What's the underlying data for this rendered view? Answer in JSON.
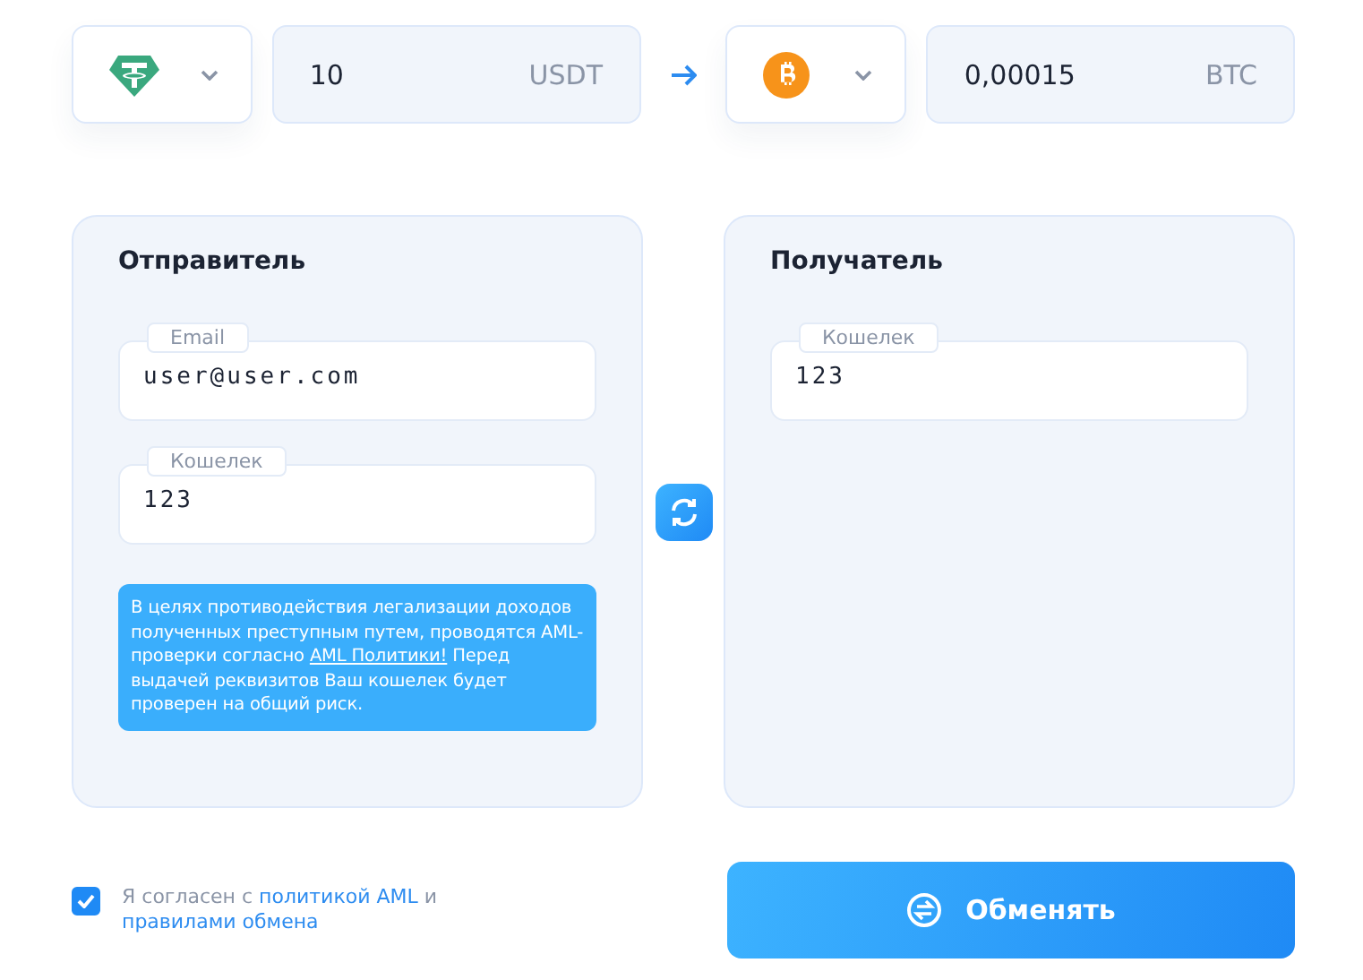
{
  "exchange": {
    "from": {
      "kind": "tether",
      "amount": "10",
      "currency": "USDT"
    },
    "to": {
      "kind": "bitcoin",
      "amount": "0,00015",
      "currency": "BTC"
    }
  },
  "sender": {
    "title": "Отправитель",
    "fields": [
      {
        "label": "Email",
        "value": "user@user.com"
      },
      {
        "label": "Кошелек",
        "value": "123"
      }
    ],
    "notice": {
      "text_before": "В целях противодействия легализации доходов полученных преступным путем, проводятся AML-проверки согласно",
      "link": "AML Политики!",
      "text_after": "Перед выдачей реквизитов Ваш кошелек будет проверен на общий риск."
    }
  },
  "recipient": {
    "title": "Получатель",
    "fields": [
      {
        "label": "Кошелек",
        "value": "123"
      }
    ]
  },
  "agreement": {
    "checked": true,
    "text": "Я согласен с",
    "link_1": "политикой AML",
    "joiner": "и",
    "link_2": "правилами обмена"
  },
  "submit": {
    "label": "Обменять"
  }
}
